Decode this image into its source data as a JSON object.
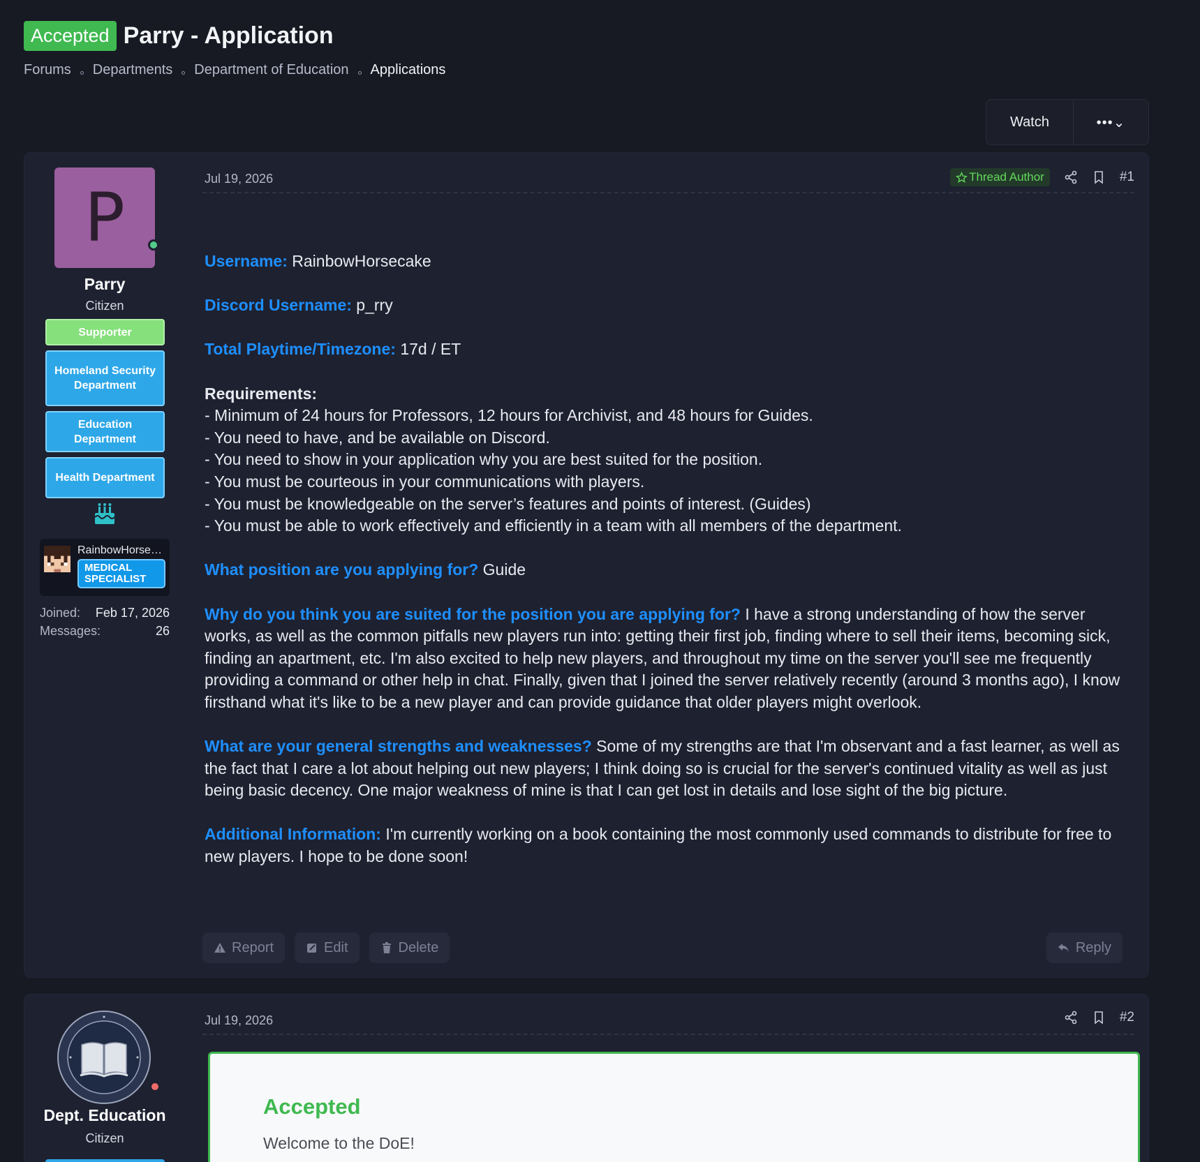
{
  "thread": {
    "prefix": "Accepted",
    "title": "Parry - Application",
    "breadcrumbs": [
      "Forums",
      "Departments",
      "Department of Education",
      "Applications"
    ]
  },
  "toolbar": {
    "watch_label": "Watch",
    "more_label": "•••⌄"
  },
  "post1": {
    "user": {
      "avatar_letter": "P",
      "name": "Parry",
      "title": "Citizen",
      "banners": [
        "Supporter",
        "Homeland Security Department",
        "Education Department",
        "Health Department"
      ],
      "mc_name": "RainbowHorsecake",
      "mc_rank": "MEDICAL SPECIALIST",
      "joined_label": "Joined:",
      "joined": "Feb 17, 2026",
      "messages_label": "Messages:",
      "messages": "26"
    },
    "date": "Jul 19, 2026",
    "author_badge": "Thread Author",
    "number": "#1",
    "fields": [
      {
        "q": "Username:",
        "a": " RainbowHorsecake"
      },
      {
        "q": "Discord Username:",
        "a": " p_rry"
      },
      {
        "q": "Total Playtime/Timezone:",
        "a": " 17d / ET"
      }
    ],
    "requirements_label": "Requirements:",
    "requirements": [
      "- Minimum of 24 hours for Professors, 12 hours for Archivist, and 48 hours for Guides.",
      "- You need to have, and be available on Discord.",
      "- You need to show in your application why you are best suited for the position.",
      "- You must be courteous in your communications with players.",
      "- You must be knowledgeable on the server’s features and points of interest. (Guides)",
      "- You must be able to work effectively and efficiently in a team with all members of the department."
    ],
    "questions": [
      {
        "q": "What position are you applying for?",
        "a": " Guide"
      },
      {
        "q": "Why do you think you are suited for the position you are applying for?",
        "a": " I have a strong understanding of how the server works, as well as the common pitfalls new players run into: getting their first job, finding where to sell their items, becoming sick, finding an apartment, etc. I'm also excited to help new players, and throughout my time on the server you'll see me frequently providing a command or other help in chat. Finally, given that I joined the server relatively recently (around 3 months ago), I know firsthand what it's like to be a new player and can provide guidance that older players might overlook."
      },
      {
        "q": "What are your general strengths and weaknesses?",
        "a": " Some of my strengths are that I'm observant and a fast learner, as well as the fact that I care a lot about helping out new players; I think doing so is crucial for the server's continued vitality as well as just being basic decency. One major weakness of mine is that I can get lost in details and lose sight of the big picture."
      },
      {
        "q": "Additional Information:",
        "a": " I'm currently working on a book containing the most commonly used commands to distribute for free to new players. I hope to be done soon!"
      }
    ],
    "actions": {
      "report": "Report",
      "edit": "Edit",
      "delete": "Delete",
      "reply": "Reply"
    }
  },
  "post2": {
    "user": {
      "name": "Dept. Education",
      "title": "Citizen"
    },
    "date": "Jul 19, 2026",
    "number": "#2",
    "mod_title": "Accepted",
    "mod_text": "Welcome to the DoE!"
  },
  "colors": {
    "accepted": "#3fb950",
    "question": "#1e8fff",
    "banner_blue": "#2ea7e8",
    "supporter": "#86e07c"
  }
}
